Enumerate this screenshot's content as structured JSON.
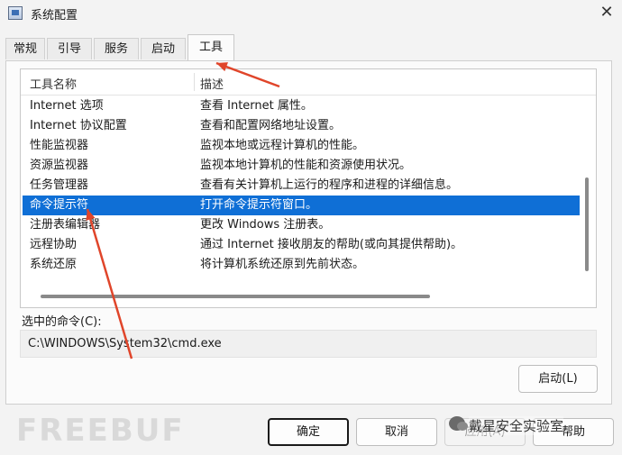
{
  "window": {
    "title": "系统配置",
    "close_glyph": "✕"
  },
  "tabs": [
    {
      "label": "常规",
      "active": false
    },
    {
      "label": "引导",
      "active": false
    },
    {
      "label": "服务",
      "active": false
    },
    {
      "label": "启动",
      "active": false
    },
    {
      "label": "工具",
      "active": true
    }
  ],
  "list": {
    "columns": [
      "工具名称",
      "描述"
    ],
    "rows": [
      {
        "name": "Internet 选项",
        "desc": "查看 Internet 属性。",
        "selected": false
      },
      {
        "name": "Internet 协议配置",
        "desc": "查看和配置网络地址设置。",
        "selected": false
      },
      {
        "name": "性能监视器",
        "desc": "监视本地或远程计算机的性能。",
        "selected": false
      },
      {
        "name": "资源监视器",
        "desc": "监视本地计算机的性能和资源使用状况。",
        "selected": false
      },
      {
        "name": "任务管理器",
        "desc": "查看有关计算机上运行的程序和进程的详细信息。",
        "selected": false
      },
      {
        "name": "命令提示符",
        "desc": "打开命令提示符窗口。",
        "selected": true
      },
      {
        "name": "注册表编辑器",
        "desc": "更改 Windows 注册表。",
        "selected": false
      },
      {
        "name": "远程协助",
        "desc": "通过 Internet 接收朋友的帮助(或向其提供帮助)。",
        "selected": false
      },
      {
        "name": "系统还原",
        "desc": "将计算机系统还原到先前状态。",
        "selected": false
      }
    ]
  },
  "command": {
    "label": "选中的命令(C):",
    "value": "C:\\WINDOWS\\System32\\cmd.exe"
  },
  "buttons": {
    "launch": "启动(L)",
    "ok": "确定",
    "cancel": "取消",
    "apply": "应用(A)",
    "help": "帮助"
  },
  "watermarks": {
    "left": "FREEBUF",
    "right": "戴星安全实验室"
  },
  "annotation_color": "#e0452a"
}
